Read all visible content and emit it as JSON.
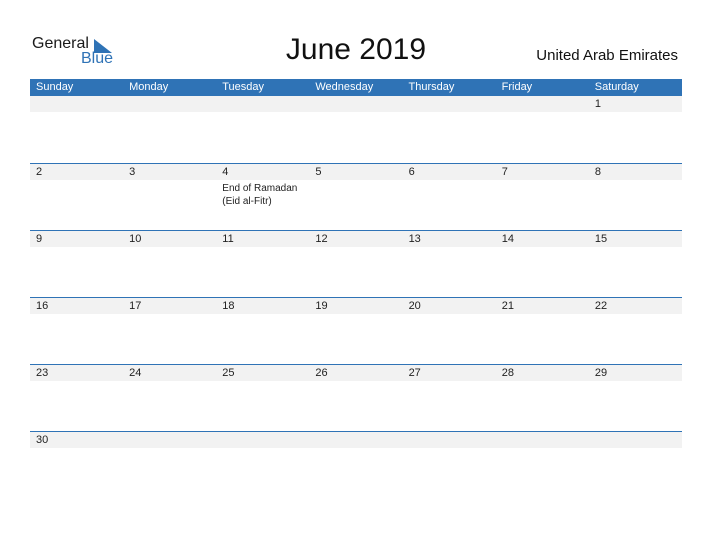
{
  "logo": {
    "word1": "General",
    "word2": "Blue"
  },
  "title": "June 2019",
  "country": "United Arab Emirates",
  "colors": {
    "accent": "#2f73b6",
    "band": "#f2f2f2"
  },
  "weekdays": [
    "Sunday",
    "Monday",
    "Tuesday",
    "Wednesday",
    "Thursday",
    "Friday",
    "Saturday"
  ],
  "weeks": [
    {
      "days": [
        "",
        "",
        "",
        "",
        "",
        "",
        "1"
      ],
      "events": [
        "",
        "",
        "",
        "",
        "",
        "",
        ""
      ]
    },
    {
      "days": [
        "2",
        "3",
        "4",
        "5",
        "6",
        "7",
        "8"
      ],
      "events": [
        "",
        "",
        "End of Ramadan (Eid al-Fitr)",
        "",
        "",
        "",
        ""
      ]
    },
    {
      "days": [
        "9",
        "10",
        "11",
        "12",
        "13",
        "14",
        "15"
      ],
      "events": [
        "",
        "",
        "",
        "",
        "",
        "",
        ""
      ]
    },
    {
      "days": [
        "16",
        "17",
        "18",
        "19",
        "20",
        "21",
        "22"
      ],
      "events": [
        "",
        "",
        "",
        "",
        "",
        "",
        ""
      ]
    },
    {
      "days": [
        "23",
        "24",
        "25",
        "26",
        "27",
        "28",
        "29"
      ],
      "events": [
        "",
        "",
        "",
        "",
        "",
        "",
        ""
      ]
    },
    {
      "days": [
        "30",
        "",
        "",
        "",
        "",
        "",
        ""
      ],
      "events": [
        "",
        "",
        "",
        "",
        "",
        "",
        ""
      ]
    }
  ]
}
